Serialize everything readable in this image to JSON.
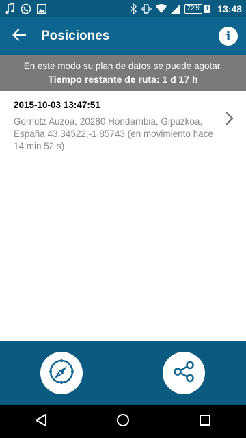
{
  "status_bar": {
    "icons": [
      "music-note-icon",
      "whatsapp-icon",
      "image-icon",
      "bluetooth-icon",
      "vibrate-icon",
      "wifi-icon",
      "signal-icon"
    ],
    "battery": "72%",
    "time": "13:48"
  },
  "app_bar": {
    "title": "Posiciones",
    "back_icon": "arrow-back-icon",
    "info_icon": "info-icon",
    "info_glyph": "i"
  },
  "banner": {
    "line1": "En este modo su plan de datos se puede agotar.",
    "line2": "Tiempo restante de ruta: 1 d 17 h"
  },
  "positions": [
    {
      "date": "2015-10-03 13:47:51",
      "description": "Gornutz Auzoa, 20280 Hondarribia, Gipuzkoa, España 43.34522,-1.85743 (en movimiento hace 14 min 52 s)"
    }
  ],
  "bottom_bar": {
    "left_button_icon": "compass-icon",
    "right_button_icon": "share-icon"
  },
  "nav_bar": {
    "icons": [
      "back-triangle-icon",
      "home-circle-icon",
      "recents-square-icon"
    ]
  },
  "colors": {
    "status_bar": "#0b5a80",
    "app_bar": "#0e6690",
    "banner": "#7a7a7a",
    "bottom_bar": "#0b5a80",
    "accent": "#0e6690"
  }
}
